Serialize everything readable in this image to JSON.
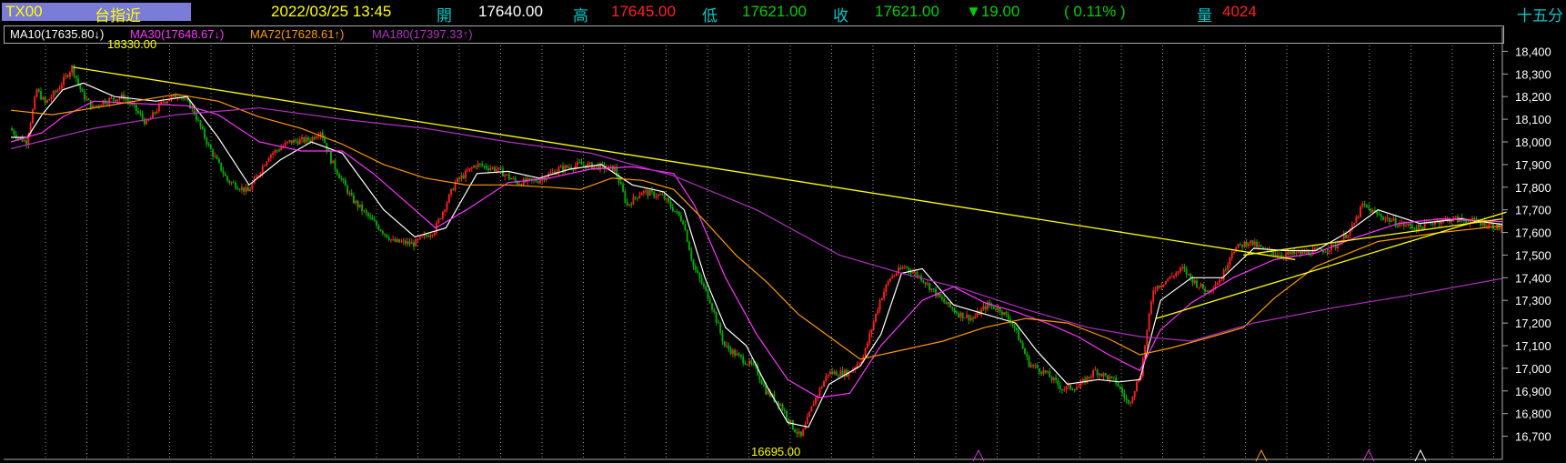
{
  "header": {
    "symbol": "TX00",
    "name": "台指近",
    "datetime": "2022/03/25 13:45",
    "open_label": "開",
    "open": "17640.00",
    "high_label": "高",
    "high": "17645.00",
    "low_label": "低",
    "low": "17621.00",
    "close_label": "收",
    "close": "17621.00",
    "change": "▼19.00",
    "change_pct": "( 0.11% )",
    "volume_label": "量",
    "volume": "4024",
    "period": "十五分"
  },
  "legend": [
    {
      "label": "MA10",
      "value": "(17635.80↓)",
      "color": "#ffffff"
    },
    {
      "label": "MA30",
      "value": "(17648.67↓)",
      "color": "#ff33ff"
    },
    {
      "label": "MA72",
      "value": "(17628.61↑)",
      "color": "#ff9900"
    },
    {
      "label": "MA180",
      "value": "(17397.33↑)",
      "color": "#b030c0"
    }
  ],
  "annotations": {
    "high_mark": "18330.00",
    "low_mark": "16695.00"
  },
  "chart_data": {
    "type": "candlestick",
    "symbol": "TX00",
    "ylim": [
      16650,
      18450
    ],
    "y_ticks": [
      "18,400",
      "18,300",
      "18,200",
      "18,100",
      "18,000",
      "17,900",
      "17,800",
      "17,700",
      "17,600",
      "17,500",
      "17,400",
      "17,300",
      "17,200",
      "17,100",
      "17,000",
      "16,900",
      "16,800",
      "16,700"
    ],
    "grid": "vertical dotted",
    "price_path": [
      [
        0,
        18060
      ],
      [
        4,
        18020
      ],
      [
        8,
        18000
      ],
      [
        13,
        18230
      ],
      [
        17,
        18170
      ],
      [
        23,
        18230
      ],
      [
        30,
        18330
      ],
      [
        35,
        18210
      ],
      [
        40,
        18150
      ],
      [
        45,
        18180
      ],
      [
        55,
        18200
      ],
      [
        60,
        18150
      ],
      [
        66,
        18080
      ],
      [
        74,
        18180
      ],
      [
        82,
        18210
      ],
      [
        88,
        18150
      ],
      [
        96,
        17980
      ],
      [
        105,
        17830
      ],
      [
        115,
        17780
      ],
      [
        125,
        17940
      ],
      [
        135,
        18000
      ],
      [
        145,
        18010
      ],
      [
        150,
        18050
      ],
      [
        155,
        17920
      ],
      [
        165,
        17750
      ],
      [
        175,
        17650
      ],
      [
        185,
        17560
      ],
      [
        195,
        17550
      ],
      [
        205,
        17610
      ],
      [
        215,
        17820
      ],
      [
        225,
        17900
      ],
      [
        235,
        17880
      ],
      [
        245,
        17820
      ],
      [
        255,
        17830
      ],
      [
        265,
        17880
      ],
      [
        275,
        17900
      ],
      [
        285,
        17890
      ],
      [
        292,
        17880
      ],
      [
        298,
        17720
      ],
      [
        305,
        17780
      ],
      [
        315,
        17760
      ],
      [
        325,
        17650
      ],
      [
        330,
        17450
      ],
      [
        338,
        17300
      ],
      [
        345,
        17100
      ],
      [
        352,
        17050
      ],
      [
        360,
        17000
      ],
      [
        365,
        16900
      ],
      [
        372,
        16840
      ],
      [
        378,
        16740
      ],
      [
        382,
        16695
      ],
      [
        388,
        16850
      ],
      [
        395,
        16980
      ],
      [
        405,
        16980
      ],
      [
        412,
        17050
      ],
      [
        420,
        17300
      ],
      [
        425,
        17400
      ],
      [
        432,
        17450
      ],
      [
        440,
        17400
      ],
      [
        450,
        17300
      ],
      [
        458,
        17240
      ],
      [
        465,
        17220
      ],
      [
        472,
        17280
      ],
      [
        478,
        17260
      ],
      [
        484,
        17200
      ],
      [
        492,
        17020
      ],
      [
        500,
        16980
      ],
      [
        508,
        16910
      ],
      [
        516,
        16920
      ],
      [
        524,
        16990
      ],
      [
        534,
        16940
      ],
      [
        540,
        16840
      ],
      [
        546,
        16980
      ],
      [
        552,
        17350
      ],
      [
        560,
        17400
      ],
      [
        566,
        17440
      ],
      [
        572,
        17380
      ],
      [
        578,
        17340
      ],
      [
        585,
        17400
      ],
      [
        590,
        17520
      ],
      [
        598,
        17560
      ],
      [
        606,
        17520
      ],
      [
        615,
        17500
      ],
      [
        625,
        17510
      ],
      [
        633,
        17520
      ],
      [
        640,
        17540
      ],
      [
        648,
        17620
      ],
      [
        653,
        17720
      ],
      [
        660,
        17680
      ],
      [
        670,
        17640
      ],
      [
        680,
        17620
      ],
      [
        688,
        17650
      ],
      [
        696,
        17660
      ],
      [
        706,
        17650
      ],
      [
        712,
        17640
      ],
      [
        719,
        17621
      ]
    ],
    "trendlines": [
      {
        "from": [
          30,
          18330
        ],
        "to": [
          620,
          17480
        ]
      },
      {
        "from": [
          553,
          17220
        ],
        "to": [
          722,
          17690
        ]
      },
      {
        "from": [
          595,
          17500
        ],
        "to": [
          720,
          17660
        ]
      }
    ],
    "series": [
      {
        "name": "MA10",
        "color": "#ffffff",
        "values": [
          [
            0,
            18020
          ],
          [
            8,
            18020
          ],
          [
            15,
            18120
          ],
          [
            25,
            18230
          ],
          [
            35,
            18260
          ],
          [
            50,
            18200
          ],
          [
            70,
            18180
          ],
          [
            85,
            18200
          ],
          [
            100,
            18020
          ],
          [
            115,
            17810
          ],
          [
            130,
            17920
          ],
          [
            145,
            18000
          ],
          [
            160,
            17950
          ],
          [
            180,
            17700
          ],
          [
            195,
            17580
          ],
          [
            210,
            17620
          ],
          [
            225,
            17860
          ],
          [
            240,
            17870
          ],
          [
            255,
            17840
          ],
          [
            270,
            17880
          ],
          [
            285,
            17900
          ],
          [
            300,
            17810
          ],
          [
            315,
            17780
          ],
          [
            325,
            17700
          ],
          [
            335,
            17400
          ],
          [
            345,
            17180
          ],
          [
            355,
            17100
          ],
          [
            365,
            16920
          ],
          [
            375,
            16760
          ],
          [
            385,
            16740
          ],
          [
            395,
            16930
          ],
          [
            410,
            17010
          ],
          [
            420,
            17150
          ],
          [
            430,
            17420
          ],
          [
            440,
            17440
          ],
          [
            455,
            17280
          ],
          [
            470,
            17240
          ],
          [
            485,
            17200
          ],
          [
            495,
            17080
          ],
          [
            510,
            16930
          ],
          [
            525,
            16950
          ],
          [
            535,
            16940
          ],
          [
            545,
            16950
          ],
          [
            555,
            17300
          ],
          [
            570,
            17400
          ],
          [
            585,
            17400
          ],
          [
            600,
            17530
          ],
          [
            615,
            17520
          ],
          [
            630,
            17520
          ],
          [
            645,
            17600
          ],
          [
            660,
            17700
          ],
          [
            680,
            17640
          ],
          [
            700,
            17660
          ],
          [
            720,
            17636
          ]
        ]
      },
      {
        "name": "MA30",
        "color": "#ff33ff",
        "values": [
          [
            0,
            18000
          ],
          [
            15,
            18040
          ],
          [
            25,
            18110
          ],
          [
            40,
            18180
          ],
          [
            60,
            18170
          ],
          [
            85,
            18160
          ],
          [
            100,
            18120
          ],
          [
            120,
            18000
          ],
          [
            140,
            17960
          ],
          [
            160,
            17960
          ],
          [
            175,
            17860
          ],
          [
            190,
            17740
          ],
          [
            205,
            17620
          ],
          [
            220,
            17700
          ],
          [
            240,
            17820
          ],
          [
            260,
            17840
          ],
          [
            280,
            17880
          ],
          [
            300,
            17890
          ],
          [
            320,
            17860
          ],
          [
            330,
            17720
          ],
          [
            345,
            17400
          ],
          [
            360,
            17150
          ],
          [
            375,
            16950
          ],
          [
            390,
            16870
          ],
          [
            405,
            16890
          ],
          [
            420,
            17100
          ],
          [
            440,
            17300
          ],
          [
            455,
            17360
          ],
          [
            470,
            17290
          ],
          [
            485,
            17250
          ],
          [
            500,
            17200
          ],
          [
            515,
            17140
          ],
          [
            530,
            17060
          ],
          [
            545,
            16990
          ],
          [
            555,
            17170
          ],
          [
            570,
            17290
          ],
          [
            590,
            17400
          ],
          [
            610,
            17480
          ],
          [
            630,
            17510
          ],
          [
            650,
            17580
          ],
          [
            670,
            17640
          ],
          [
            690,
            17660
          ],
          [
            720,
            17648
          ]
        ]
      },
      {
        "name": "MA72",
        "color": "#ff9900",
        "values": [
          [
            0,
            18140
          ],
          [
            20,
            18120
          ],
          [
            40,
            18150
          ],
          [
            60,
            18180
          ],
          [
            80,
            18210
          ],
          [
            100,
            18180
          ],
          [
            120,
            18110
          ],
          [
            140,
            18060
          ],
          [
            160,
            17990
          ],
          [
            180,
            17900
          ],
          [
            200,
            17840
          ],
          [
            220,
            17810
          ],
          [
            240,
            17810
          ],
          [
            260,
            17800
          ],
          [
            275,
            17790
          ],
          [
            290,
            17840
          ],
          [
            305,
            17830
          ],
          [
            320,
            17790
          ],
          [
            335,
            17650
          ],
          [
            350,
            17500
          ],
          [
            365,
            17380
          ],
          [
            380,
            17240
          ],
          [
            395,
            17140
          ],
          [
            410,
            17040
          ],
          [
            430,
            17080
          ],
          [
            450,
            17120
          ],
          [
            470,
            17180
          ],
          [
            490,
            17220
          ],
          [
            510,
            17200
          ],
          [
            530,
            17130
          ],
          [
            545,
            17060
          ],
          [
            560,
            17090
          ],
          [
            580,
            17140
          ],
          [
            595,
            17180
          ],
          [
            610,
            17310
          ],
          [
            630,
            17450
          ],
          [
            660,
            17560
          ],
          [
            690,
            17600
          ],
          [
            720,
            17629
          ]
        ]
      },
      {
        "name": "MA180",
        "color": "#b030c0",
        "values": [
          [
            0,
            17970
          ],
          [
            40,
            18060
          ],
          [
            80,
            18120
          ],
          [
            120,
            18150
          ],
          [
            160,
            18100
          ],
          [
            200,
            18060
          ],
          [
            240,
            18000
          ],
          [
            280,
            17950
          ],
          [
            320,
            17850
          ],
          [
            360,
            17700
          ],
          [
            400,
            17500
          ],
          [
            430,
            17420
          ],
          [
            460,
            17350
          ],
          [
            490,
            17260
          ],
          [
            520,
            17180
          ],
          [
            545,
            17140
          ],
          [
            570,
            17120
          ],
          [
            600,
            17200
          ],
          [
            640,
            17270
          ],
          [
            680,
            17330
          ],
          [
            720,
            17397
          ]
        ]
      }
    ]
  }
}
